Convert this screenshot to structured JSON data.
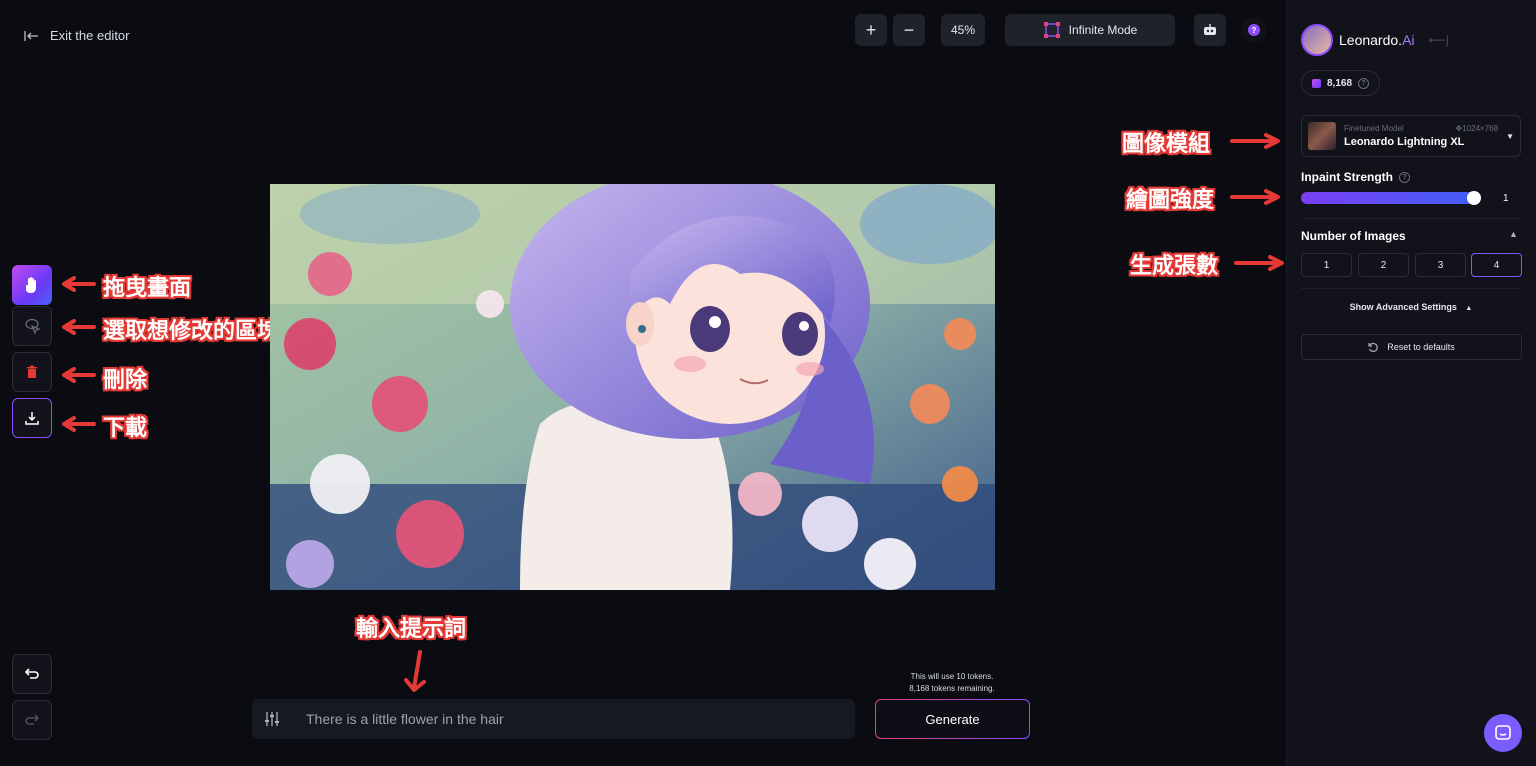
{
  "header": {
    "exit_label": "Exit the editor",
    "zoom_level": "45%",
    "mode_label": "Infinite Mode"
  },
  "brand": {
    "name": "Leonardo.",
    "name_suffix": "Ai",
    "credits": "8,168"
  },
  "model": {
    "type_label": "Finetuned Model",
    "resolution": "1024×768",
    "name": "Leonardo Lightning XL"
  },
  "settings": {
    "inpaint_label": "Inpaint Strength",
    "inpaint_value": "1",
    "inpaint_fraction": 1.0,
    "num_images_label": "Number of Images",
    "num_images_options": [
      "1",
      "2",
      "3",
      "4"
    ],
    "num_images_selected": "4",
    "advanced_label": "Show Advanced Settings",
    "reset_label": "Reset to defaults"
  },
  "prompt": {
    "text": "There is a little flower in the hair",
    "tokens_line1": "This will use 10 tokens.",
    "tokens_line2": "8,168 tokens remaining.",
    "generate_label": "Generate"
  },
  "annotations": {
    "pan": "拖曳畫面",
    "select": "選取想修改的區塊",
    "delete": "刪除",
    "download": "下載",
    "prompt": "輸入提示詞",
    "model": "圖像模組",
    "strength": "繪圖強度",
    "count": "生成張數"
  },
  "colors": {
    "accent": "#8b4dff",
    "annotation_outline": "#e53935"
  }
}
